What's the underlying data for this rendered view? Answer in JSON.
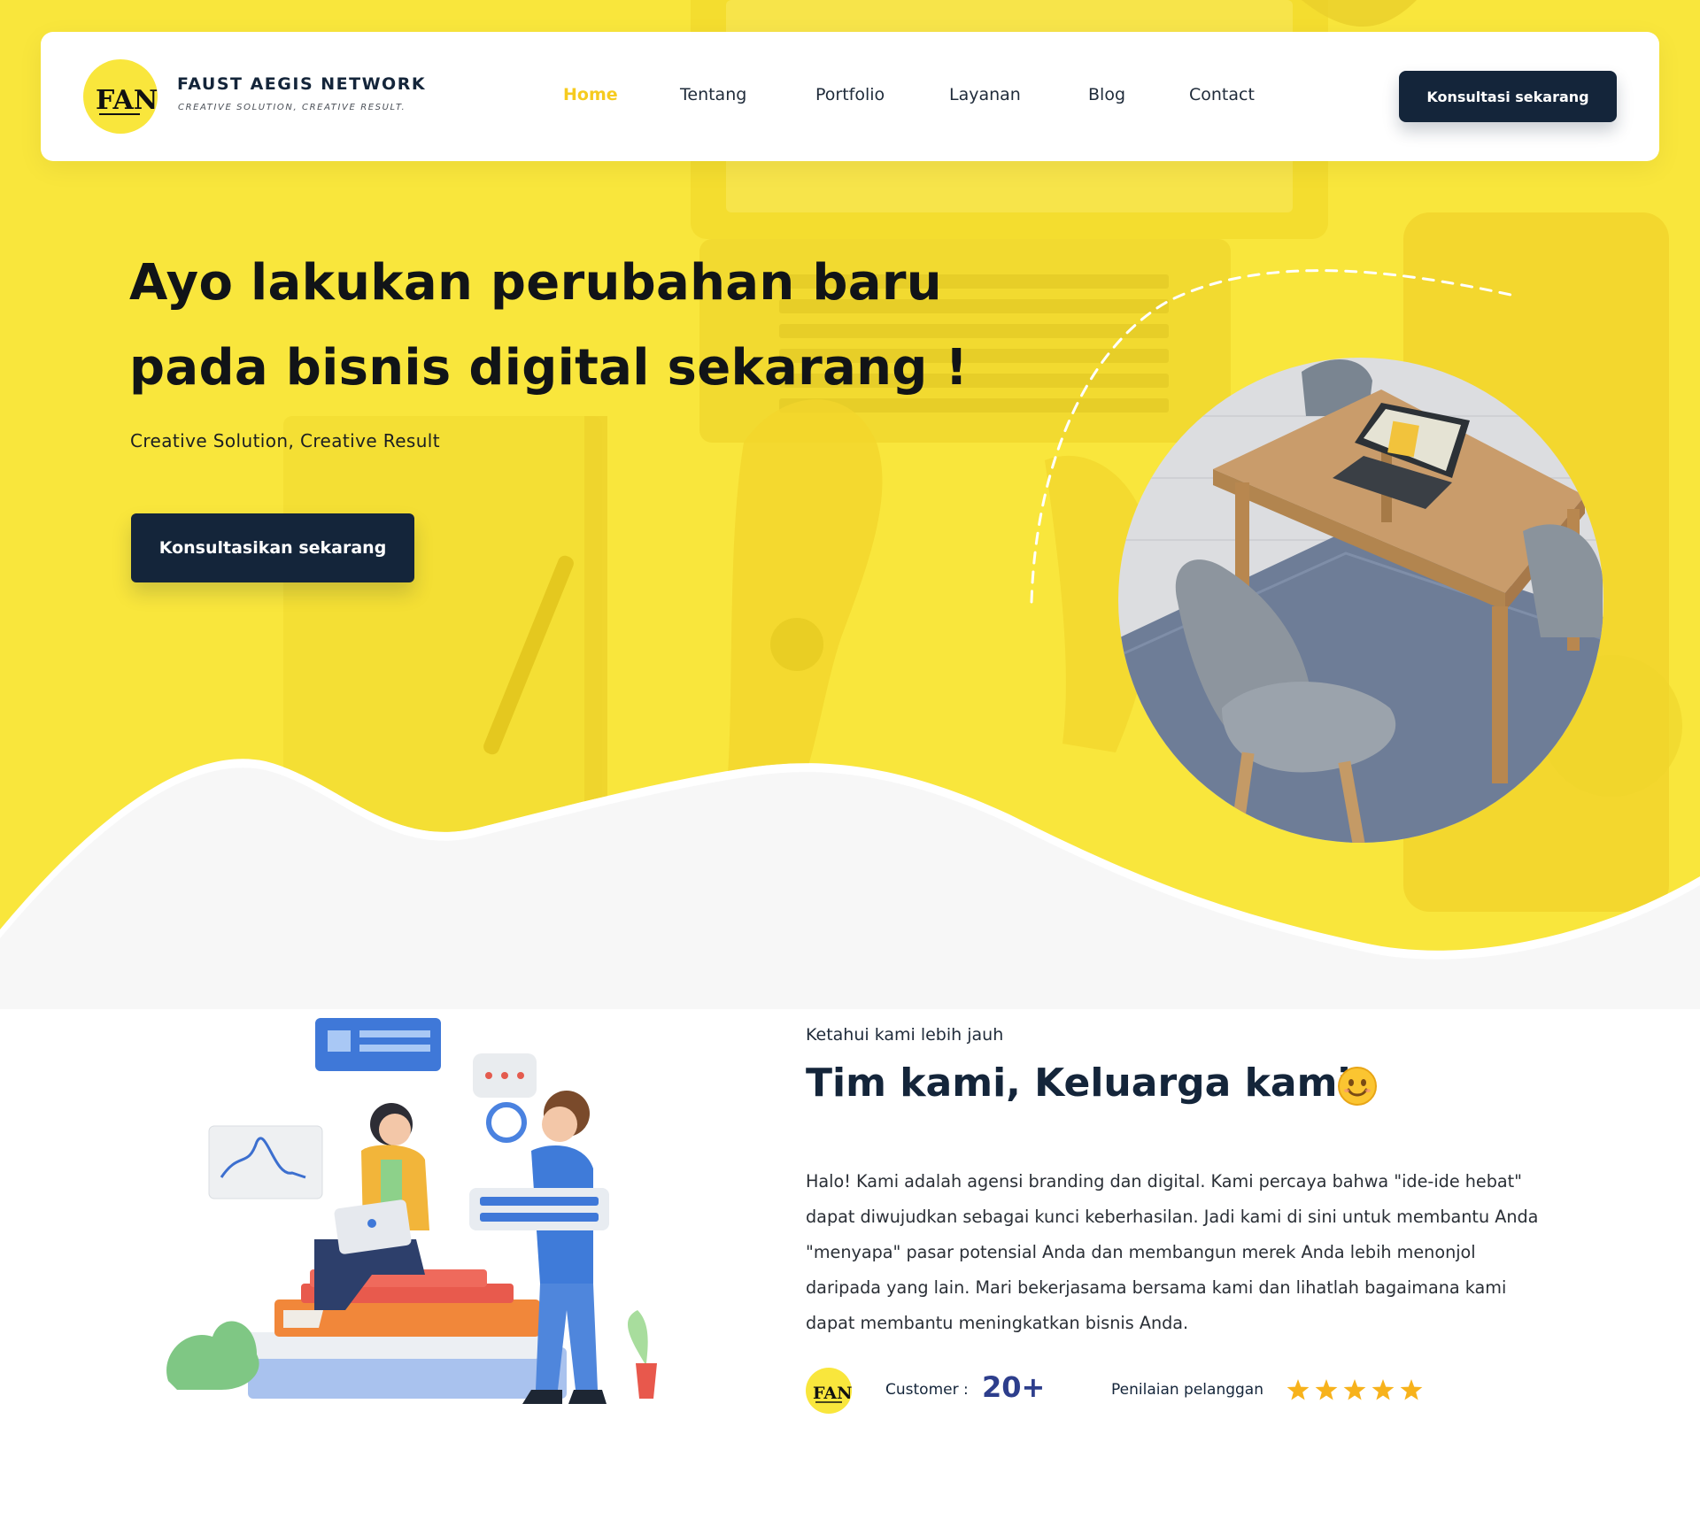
{
  "colors": {
    "brand_yellow": "#F9E63C",
    "navy": "#14253A",
    "active_link": "#F6CB1F",
    "star": "#F7B21B"
  },
  "brand": {
    "logo_text": "FAN",
    "name": "FAUST AEGIS NETWORK",
    "tagline": "CREATIVE SOLUTION, CREATIVE RESULT."
  },
  "nav": {
    "links": [
      {
        "label": "Home",
        "active": true
      },
      {
        "label": "Tentang",
        "active": false
      },
      {
        "label": "Portfolio",
        "active": false
      },
      {
        "label": "Layanan",
        "active": false
      },
      {
        "label": "Blog",
        "active": false
      },
      {
        "label": "Contact",
        "active": false
      }
    ],
    "cta_label": "Konsultasi sekarang"
  },
  "hero": {
    "title_line1": "Ayo lakukan perubahan baru",
    "title_line2": "pada bisnis digital sekarang !",
    "subtitle": "Creative Solution, Creative Result",
    "cta_label": "Konsultasikan sekarang",
    "photo_icon": "office-table-chairs-photo"
  },
  "about": {
    "eyebrow": "Ketahui kami lebih jauh",
    "title": "Tim kami, Keluarga kami",
    "title_emoji_icon": "smiling-face-icon",
    "body": "Halo! Kami adalah agensi branding dan digital. Kami percaya bahwa \"ide-ide hebat\" dapat diwujudkan sebagai kunci keberhasilan. Jadi kami di sini untuk membantu Anda \"menyapa\" pasar potensial Anda dan membangun merek Anda lebih menonjol daripada yang  lain. Mari bekerjasama bersama kami dan lihatlah bagaimana kami dapat membantu meningkatkan bisnis Anda.",
    "illustration_icon": "team-working-3d-illustration",
    "stats": {
      "customer_label": "Customer :",
      "customer_value": "20+",
      "rating_label": "Penilaian pelanggan",
      "rating": 5,
      "rating_max": 5
    }
  }
}
